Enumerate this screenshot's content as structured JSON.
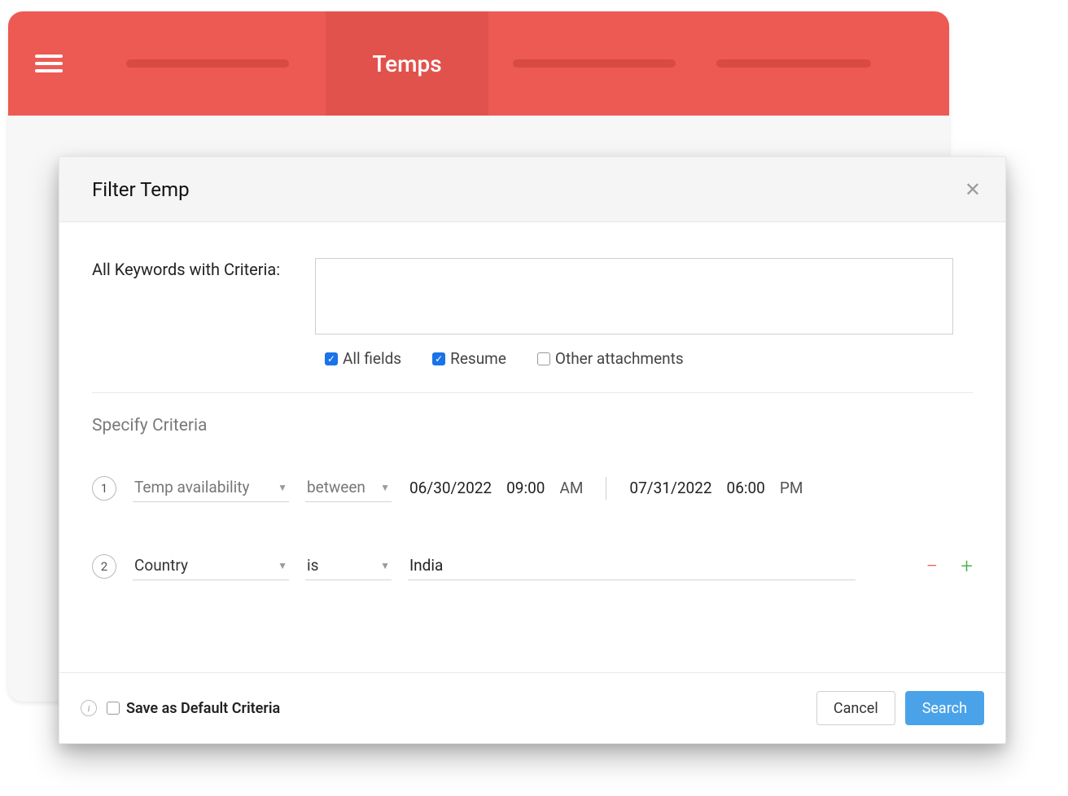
{
  "header": {
    "active_tab_label": "Temps"
  },
  "modal": {
    "title": "Filter Temp",
    "keywords": {
      "label": "All Keywords with Criteria:",
      "value": "",
      "checks": {
        "all_fields": {
          "label": "All fields",
          "checked": true
        },
        "resume": {
          "label": "Resume",
          "checked": true
        },
        "other": {
          "label": "Other attachments",
          "checked": false
        }
      }
    },
    "specify_label": "Specify Criteria",
    "criteria": [
      {
        "num": "1",
        "field": "Temp availability",
        "op": "between",
        "from_date": "06/30/2022",
        "from_time": "09:00",
        "from_ampm": "AM",
        "to_date": "07/31/2022",
        "to_time": "06:00",
        "to_ampm": "PM"
      },
      {
        "num": "2",
        "field": "Country",
        "op": "is",
        "value": "India"
      }
    ],
    "footer": {
      "save_default_label": "Save as Default Criteria",
      "cancel_label": "Cancel",
      "search_label": "Search"
    }
  }
}
